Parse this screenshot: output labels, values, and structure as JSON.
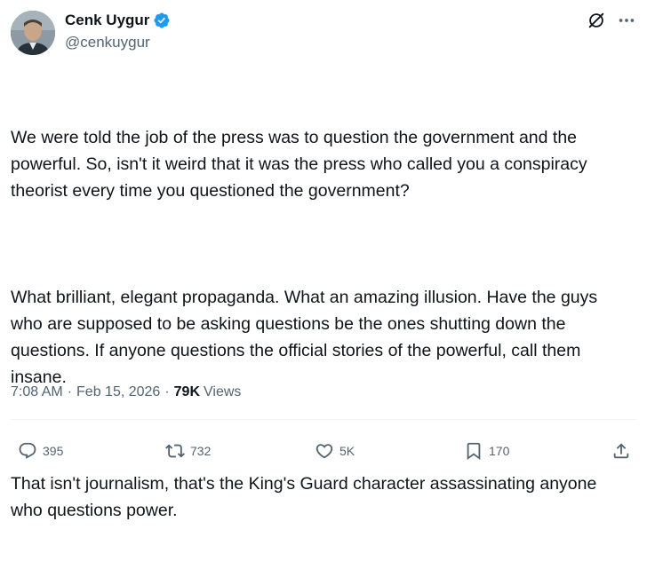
{
  "author": {
    "display_name": "Cenk Uygur",
    "handle": "@cenkuygur",
    "verified": true,
    "avatar_icon": "avatar-photo"
  },
  "header_icons": [
    "grok-icon",
    "more-options-icon"
  ],
  "tweet": {
    "paragraphs": [
      "We were told the job of the press was to question the government and the powerful. So, isn't it weird that it was the press who called you a conspiracy theorist every time you questioned the government?",
      "What brilliant, elegant propaganda. What an amazing illusion. Have the guys who are supposed to be asking questions be the ones shutting down the questions. If anyone questions the official stories of the powerful, call them insane.",
      "That isn't journalism, that's the King's Guard character assassinating anyone who questions power."
    ]
  },
  "meta": {
    "time": "7:08 AM",
    "date": "Feb 15, 2026",
    "views_count": "79K",
    "views_label": "Views"
  },
  "actions": {
    "replies": "395",
    "reposts": "732",
    "likes": "5K",
    "bookmarks": "170"
  },
  "colors": {
    "text": "#0f1419",
    "secondary": "#536471",
    "verified": "#1d9bf0",
    "divider": "#eff3f4"
  }
}
